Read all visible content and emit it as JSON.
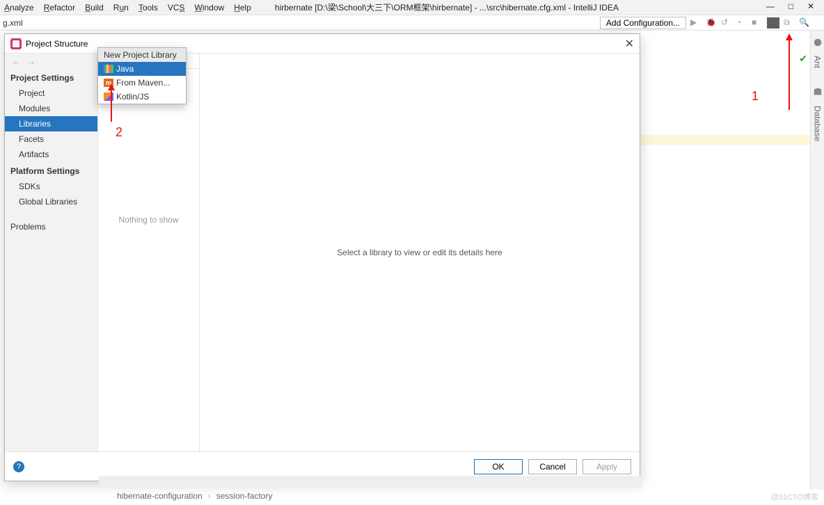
{
  "menu": {
    "items": [
      "Analyze",
      "Refactor",
      "Build",
      "Run",
      "Tools",
      "VCS",
      "Window",
      "Help"
    ],
    "underline": [
      "A",
      "R",
      "B",
      "R",
      "T",
      "V",
      "W",
      "H"
    ]
  },
  "title": "hirbernate [D:\\梁\\School\\大三下\\ORM框架\\hirbernate] - ...\\src\\hibernate.cfg.xml - IntelliJ IDEA",
  "tab": "g.xml",
  "toolbar": {
    "addconf": "Add Configuration..."
  },
  "rightGutter": {
    "labels": [
      "Ant",
      "Database"
    ]
  },
  "dialog": {
    "title": "Project Structure",
    "nav": {
      "h1": "Project Settings",
      "items1": [
        "Project",
        "Modules",
        "Libraries",
        "Facets",
        "Artifacts"
      ],
      "selected": "Libraries",
      "h2": "Platform Settings",
      "items2": [
        "SDKs",
        "Global Libraries"
      ],
      "h3": "",
      "items3": [
        "Problems"
      ]
    },
    "mid_empty": "Nothing to show",
    "popup": {
      "header": "New Project Library",
      "items": [
        "Java",
        "From Maven...",
        "Kotlin/JS"
      ],
      "selected": "Java"
    },
    "detail": "Select a library to view or edit its details here",
    "buttons": {
      "ok": "OK",
      "cancel": "Cancel",
      "apply": "Apply"
    }
  },
  "breadcrumb": [
    "hibernate-configuration",
    "session-factory"
  ],
  "annotations": {
    "a1": "1",
    "a2": "2"
  },
  "watermark": "@51CTO博客"
}
